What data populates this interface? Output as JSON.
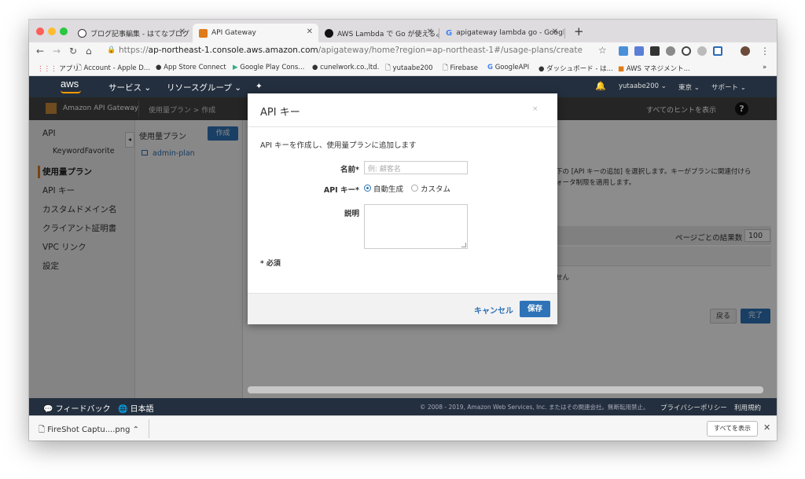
{
  "browser": {
    "tabs": [
      {
        "label": "ブログ記事編集 - はてなブログ"
      },
      {
        "label": "API Gateway"
      },
      {
        "label": "AWS Lambda で Go が使えるよ"
      },
      {
        "label": "apigateway lambda go - Googl"
      }
    ],
    "url": {
      "scheme": "https://",
      "host": "ap-northeast-1.console.aws.amazon.com",
      "path": "/apigateway/home?region=ap-northeast-1#/usage-plans/create"
    },
    "bookmarks": [
      "アプリ",
      "Account - Apple D...",
      "App Store Connect",
      "Google Play Cons...",
      "cunelwork.co.,ltd.",
      "yutaabe200",
      "Firebase",
      "GoogleAPI",
      "ダッシュボード - は...",
      "AWS マネジメント..."
    ]
  },
  "aws": {
    "logo": "aws",
    "menu_services": "サービス",
    "menu_resource_groups": "リソースグループ",
    "user": "yutaabe200",
    "region": "東京",
    "support": "サポート"
  },
  "service": {
    "name": "Amazon API Gateway",
    "breadcrumb": "使用量プラン  >  作成",
    "hints": "すべてのヒントを表示"
  },
  "sidebar": {
    "items": [
      {
        "label": "API"
      },
      {
        "label": "KeywordFavorite"
      },
      {
        "label": "使用量プラン"
      },
      {
        "label": "API キー"
      },
      {
        "label": "カスタムドメイン名"
      },
      {
        "label": "クライアント証明書"
      },
      {
        "label": "VPC リンク"
      },
      {
        "label": "設定"
      }
    ]
  },
  "plans": {
    "header": "使用量プラン",
    "create": "作成",
    "items": [
      "admin-plan"
    ]
  },
  "background": {
    "line1": "下の [API キーの追加] を選択します。キーがプランに関連付けら",
    "line2": "ォータ制限を適用します。",
    "per_page_label": "ページごとの結果数",
    "per_page_value": "100",
    "empty_fragment": "せん",
    "back": "戻る",
    "done": "完了"
  },
  "modal": {
    "title": "API キー",
    "close": "×",
    "description": "API キーを作成し、使用量プランに追加します",
    "name_label": "名前*",
    "name_placeholder": "例: 顧客名",
    "key_label": "API キー*",
    "auto_label": "自動生成",
    "custom_label": "カスタム",
    "desc_label": "説明",
    "required_note": "* 必須",
    "cancel": "キャンセル",
    "save": "保存"
  },
  "footer": {
    "feedback": "フィードバック",
    "language": "日本語",
    "copyright": "© 2008 - 2019, Amazon Web Services, Inc. またはその関連会社。無断転用禁止。",
    "privacy": "プライバシーポリシー",
    "terms": "利用規約"
  },
  "downloads": {
    "file": "FireShot Captu....png",
    "show_all": "すべてを表示"
  },
  "colors": {
    "aws_nav": "#232f3e",
    "aws_orange": "#ff9900",
    "primary_button": "#2e73b8",
    "link": "#2e6fb3"
  }
}
